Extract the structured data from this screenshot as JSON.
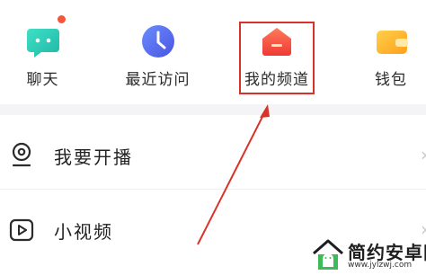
{
  "grid": {
    "items": [
      {
        "label": "聊天",
        "icon": "chat-bubble-icon",
        "color": "#2ec9b4",
        "badge": true
      },
      {
        "label": "最近访问",
        "icon": "clock-icon",
        "color": "#5a6ff0"
      },
      {
        "label": "我的频道",
        "icon": "channel-house-icon",
        "color": "#f2473c"
      },
      {
        "label": "钱包",
        "icon": "wallet-icon",
        "color": "#ffb32b"
      }
    ]
  },
  "list": {
    "items": [
      {
        "label": "我要开播",
        "icon": "live-camera-icon"
      },
      {
        "label": "小视频",
        "icon": "play-video-icon"
      }
    ]
  },
  "watermark": {
    "title": "简约安卓网",
    "url": "www.jylzwj.com"
  },
  "colors": {
    "highlight": "#d9322b",
    "arrow": "#d9322b"
  }
}
